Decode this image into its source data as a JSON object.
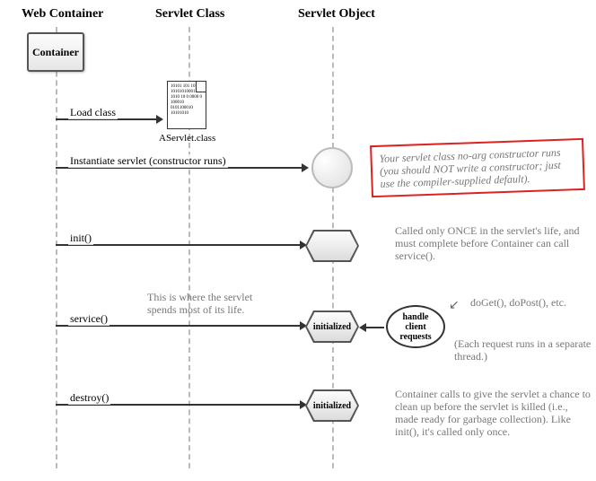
{
  "headers": {
    "web_container": "Web Container",
    "servlet_class": "Servlet Class",
    "servlet_object": "Servlet Object"
  },
  "container_label": "Container",
  "file_caption": "AServlet.class",
  "file_binary": "10101\n101 10\n10101010001\n1010 10 0\n0000 0\n100010\n0101100010\n10101010",
  "arrows": {
    "load_class": "Load class",
    "instantiate": "Instantiate servlet (constructor runs)",
    "init": "init()",
    "service": "service()",
    "destroy": "destroy()"
  },
  "hex_initialized": "initialized",
  "oval_label": "handle\nclient\nrequests",
  "notes": {
    "constructor": "Your servlet class no-arg constructor runs (you should NOT write a constructor; just use the compiler-supplied default).",
    "init": "Called only ONCE in the servlet's life, and must complete before Container can call service().",
    "spends": "This is where the servlet spends most of its life.",
    "doget": "doGet(), doPost(), etc.",
    "thread": "(Each request runs in a separate thread.)",
    "destroy": "Container calls to give the servlet a chance to clean up before the servlet is killed (i.e., made ready for garbage collection). Like init(), it's called only once."
  }
}
